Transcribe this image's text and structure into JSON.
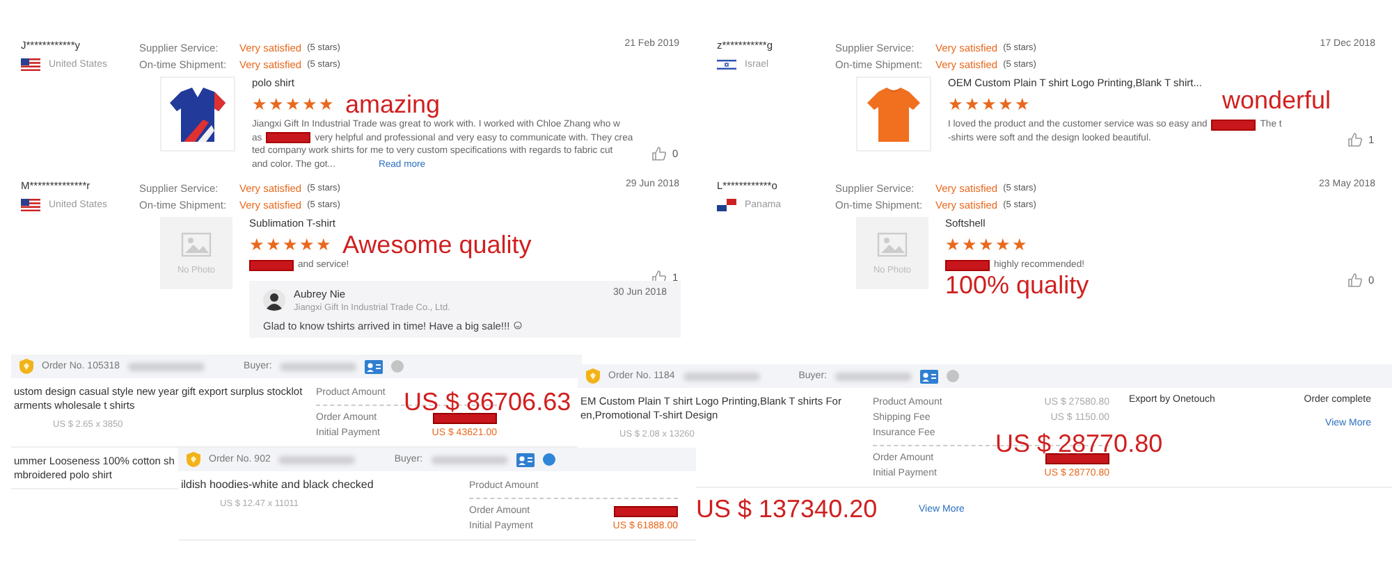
{
  "reviews": [
    {
      "buyer": "J************y",
      "country": "United States",
      "flag": {
        "kind": "us"
      },
      "date": "21 Feb 2019",
      "ratings": [
        {
          "label": "Supplier Service:",
          "value": "Very satisfied",
          "note": "(5 stars)"
        },
        {
          "label": "On-time Shipment:",
          "value": "Very satisfied",
          "note": "(5 stars)"
        }
      ],
      "product": "polo shirt",
      "photo": {
        "kind": "polo"
      },
      "stars": 5,
      "annotation": {
        "text": "amazing",
        "kind": "inline"
      },
      "text_lines": [
        [
          {
            "kind": "text",
            "text": "Jiangxi Gift In Industrial Trade was great to work with. I worked with Chloe Zhang who w"
          }
        ],
        [
          {
            "kind": "text",
            "text": "as"
          },
          {
            "kind": "redaction"
          },
          {
            "kind": "text",
            "text": "very helpful and professional and very easy to communicate with. They crea"
          }
        ],
        [
          {
            "kind": "text",
            "text": "ted company work shirts for me to very custom specifications with regards to fabric cut"
          }
        ],
        [
          {
            "kind": "text",
            "text": "and color. The got..."
          },
          {
            "kind": "link",
            "text": "Read more"
          }
        ]
      ],
      "likes": "0"
    },
    {
      "buyer": "z***********g",
      "country": "Israel",
      "flag": {
        "kind": "il"
      },
      "date": "17 Dec 2018",
      "ratings": [
        {
          "label": "Supplier Service:",
          "value": "Very satisfied",
          "note": "(5 stars)"
        },
        {
          "label": "On-time Shipment:",
          "value": "Very satisfied",
          "note": "(5 stars)"
        }
      ],
      "product": "OEM Custom Plain T shirt Logo Printing,Blank T shirt...",
      "photo": {
        "kind": "tshirt"
      },
      "stars": 5,
      "annotation": {
        "text": "wonderful",
        "kind": "over"
      },
      "text_lines": [
        [
          {
            "kind": "text",
            "text": "I loved the product and the customer service was so easy and"
          },
          {
            "kind": "redaction"
          },
          {
            "kind": "text",
            "text": "The t"
          }
        ],
        [
          {
            "kind": "text",
            "text": "-shirts were soft and the design looked beautiful."
          }
        ]
      ],
      "likes": "1"
    },
    {
      "buyer": "M**************r",
      "country": "United States",
      "flag": {
        "kind": "us"
      },
      "date": "29 Jun 2018",
      "ratings": [
        {
          "label": "Supplier Service:",
          "value": "Very satisfied",
          "note": "(5 stars)"
        },
        {
          "label": "On-time Shipment:",
          "value": "Very satisfied",
          "note": "(5 stars)"
        }
      ],
      "product": "Sublimation T-shirt",
      "photo": {
        "kind": "placeholder",
        "text": "No Photo"
      },
      "stars": 5,
      "annotation": {
        "text": "Awesome quality",
        "kind": "inline"
      },
      "text_lines": [
        [
          {
            "kind": "redaction"
          },
          {
            "kind": "text",
            "text": "and service!"
          }
        ]
      ],
      "likes": "1",
      "reply": {
        "name": "Aubrey Nie",
        "company": "Jiangxi Gift In Industrial Trade Co., Ltd.",
        "date": "30 Jun 2018",
        "text": "Glad to know tshirts arrived in time! Have a big sale!!!"
      }
    },
    {
      "buyer": "L************o",
      "country": "Panama",
      "flag": {
        "kind": "pa"
      },
      "date": "23 May 2018",
      "ratings": [
        {
          "label": "Supplier Service:",
          "value": "Very satisfied",
          "note": "(5 stars)"
        },
        {
          "label": "On-time Shipment:",
          "value": "Very satisfied",
          "note": "(5 stars)"
        }
      ],
      "product": "Softshell",
      "photo": {
        "kind": "placeholder",
        "text": "No Photo"
      },
      "stars": 5,
      "annotation": {
        "text": "100% quality",
        "kind": "below"
      },
      "text_lines": [
        [
          {
            "kind": "redaction"
          },
          {
            "kind": "text",
            "text": "highly recommended!"
          }
        ]
      ],
      "likes": "0"
    }
  ],
  "orders": [
    {
      "order_no": "Order No. 105318",
      "buyer": "Buyer:",
      "color": "#c4c4c4",
      "products": [
        {
          "title": "ustom design casual style new year gift export surplus stocklot\narments wholesale t shirts",
          "price": "US $ 2.65 x 3850"
        },
        {
          "title": "ummer Looseness 100% cotton sh\nmbroidered polo shirt"
        }
      ],
      "amounts": [
        {
          "label": "Product Amount",
          "kind": "plain"
        },
        {
          "kind": "divider"
        },
        {
          "label": "Order Amount",
          "kind": "redacted"
        },
        {
          "label": "Initial Payment",
          "value": "US $ 43621.00",
          "kind": "orange"
        }
      ],
      "annotation": "US $ 86706.63"
    },
    {
      "order_no": "Order No. 1184",
      "buyer": "Buyer:",
      "color": "#c4c4c4",
      "products": [
        {
          "title": "EM Custom Plain T shirt Logo Printing,Blank T shirts For\nen,Promotional T-shirt Design",
          "price": "US $ 2.08 x 13260"
        }
      ],
      "amounts": [
        {
          "label": "Product Amount",
          "value": "US $ 27580.80",
          "kind": "plain"
        },
        {
          "label": "Shipping Fee",
          "value": "US $ 1150.00",
          "kind": "plain"
        },
        {
          "label": "Insurance Fee",
          "kind": "plain"
        },
        {
          "kind": "divider"
        },
        {
          "label": "Order Amount",
          "kind": "redacted"
        },
        {
          "label": "Initial Payment",
          "value": "US $ 28770.80",
          "kind": "orange"
        }
      ],
      "export": "Export by Onetouch",
      "status": "Order complete",
      "side_link": "View More",
      "bottom_link": "View More",
      "annotation": "US $ 28770.80"
    },
    {
      "order_no": "Order No. 902",
      "buyer": "Buyer:",
      "color": "#2f86d6",
      "products": [
        {
          "title": "ildish hoodies-white and black checked",
          "price": "US $ 12.47 x 11011"
        }
      ],
      "amounts": [
        {
          "label": "Product Amount",
          "kind": "plain"
        },
        {
          "kind": "divider"
        },
        {
          "label": "Order Amount",
          "kind": "redacted"
        },
        {
          "label": "Initial Payment",
          "value": "US $ 61888.00",
          "kind": "orange"
        }
      ],
      "annotation": "US $ 137340.20"
    }
  ]
}
